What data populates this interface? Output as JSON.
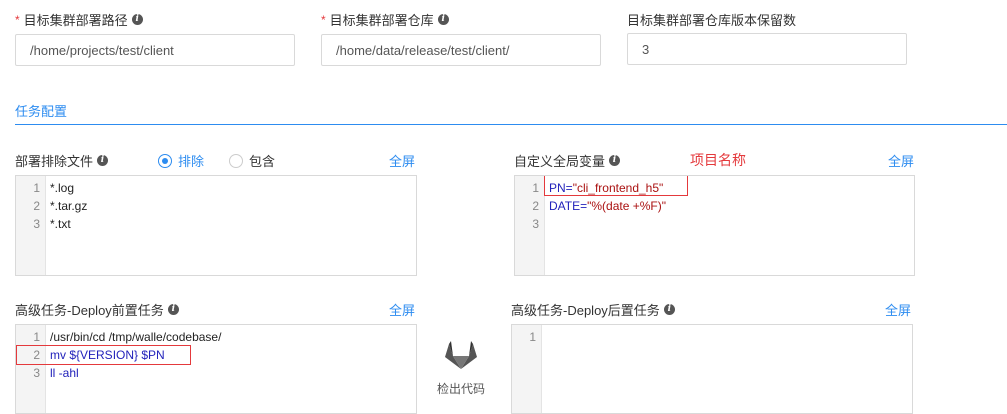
{
  "fields": {
    "deploy_path_label": "目标集群部署路径",
    "deploy_path_value": "/home/projects/test/client",
    "deploy_repo_label": "目标集群部署仓库",
    "deploy_repo_value": "/home/data/release/test/client/",
    "keep_versions_label": "目标集群部署仓库版本保留数",
    "keep_versions_value": "3"
  },
  "section": {
    "title": "任务配置"
  },
  "exclude": {
    "label": "部署排除文件",
    "option_exclude": "排除",
    "option_include": "包含",
    "selected": "排除",
    "fullscreen": "全屏",
    "lines": [
      "1",
      "2",
      "3"
    ],
    "code": [
      "*.log",
      "*.tar.gz",
      "*.txt"
    ]
  },
  "globals": {
    "label": "自定义全局变量",
    "annotation": "项目名称",
    "fullscreen": "全屏",
    "lines": [
      "1",
      "2",
      "3"
    ],
    "line1_key": "PN=",
    "line1_val": "\"cli_frontend_h5\"",
    "line2_key": "DATE=",
    "line2_val": "\"%(date +%F)\""
  },
  "pre_deploy": {
    "label": "高级任务-Deploy前置任务",
    "fullscreen": "全屏",
    "lines": [
      "1",
      "2",
      "3"
    ],
    "code": [
      "/usr/bin/cd /tmp/walle/codebase/",
      "mv ${VERSION}  $PN",
      "ll -ahl"
    ]
  },
  "checkout": {
    "label": "检出代码",
    "icon": "gitlab-icon"
  },
  "post_deploy": {
    "label": "高级任务-Deploy后置任务",
    "fullscreen": "全屏",
    "lines": [
      "1"
    ]
  },
  "colors": {
    "accent": "#2d8cf0",
    "required": "#e4393c"
  }
}
